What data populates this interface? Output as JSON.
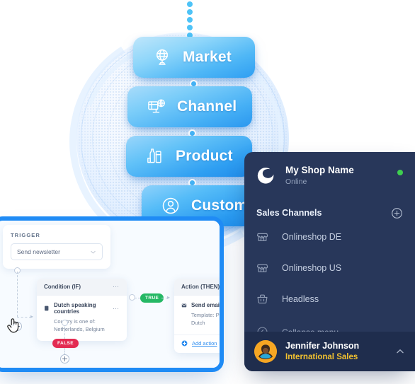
{
  "stack": {
    "cards": [
      {
        "label": "Market",
        "icon": "globe-stand-icon"
      },
      {
        "label": "Channel",
        "icon": "monitor-globe-icon"
      },
      {
        "label": "Product",
        "icon": "bottles-icon"
      },
      {
        "label": "Customer",
        "icon": "user-circle-icon"
      }
    ]
  },
  "sidebar": {
    "shop_name": "My Shop Name",
    "shop_status": "Online",
    "status_color": "#3ecf4f",
    "logo_icon": "shop-logo-icon",
    "add_icon": "plus-circle-icon",
    "section_title": "Sales Channels",
    "items": [
      {
        "label": "Onlineshop DE",
        "icon": "storefront-icon"
      },
      {
        "label": "Onlineshop US",
        "icon": "storefront-icon"
      },
      {
        "label": "Headless",
        "icon": "basket-icon"
      }
    ],
    "collapse_label": "Collapse menu",
    "collapse_icon": "chevron-left-circle-icon",
    "user": {
      "name": "Jennifer Johnson",
      "role": "International Sales",
      "role_color": "#f2c230",
      "avatar_icon": "avatar-icon",
      "chevron_icon": "chevron-up-icon"
    }
  },
  "workflow": {
    "trigger_label": "TRIGGER",
    "trigger_value": "Send newsletter",
    "trigger_chevron_icon": "chevron-down-icon",
    "condition": {
      "title": "Condition (IF)",
      "menu_icon": "ellipsis-icon",
      "row_title": "Dutch speaking countries",
      "row_icon": "condition-icon",
      "row_menu_icon": "ellipsis-icon",
      "row_sub": "Country  is one of:  Netherlands, Belgium"
    },
    "action": {
      "title": "Action (THEN)",
      "row_title": "Send email",
      "row_icon": "envelope-icon",
      "row_sub": "Template:  Promotion - Dutch",
      "add_action_label": "Add action",
      "add_action_icon": "plus-circle-icon"
    },
    "badges": {
      "true_label": "TRUE",
      "false_label": "FALSE",
      "true_color": "#25b865",
      "false_color": "#e32b52"
    },
    "cursor_icon": "hand-pointer-cursor"
  }
}
